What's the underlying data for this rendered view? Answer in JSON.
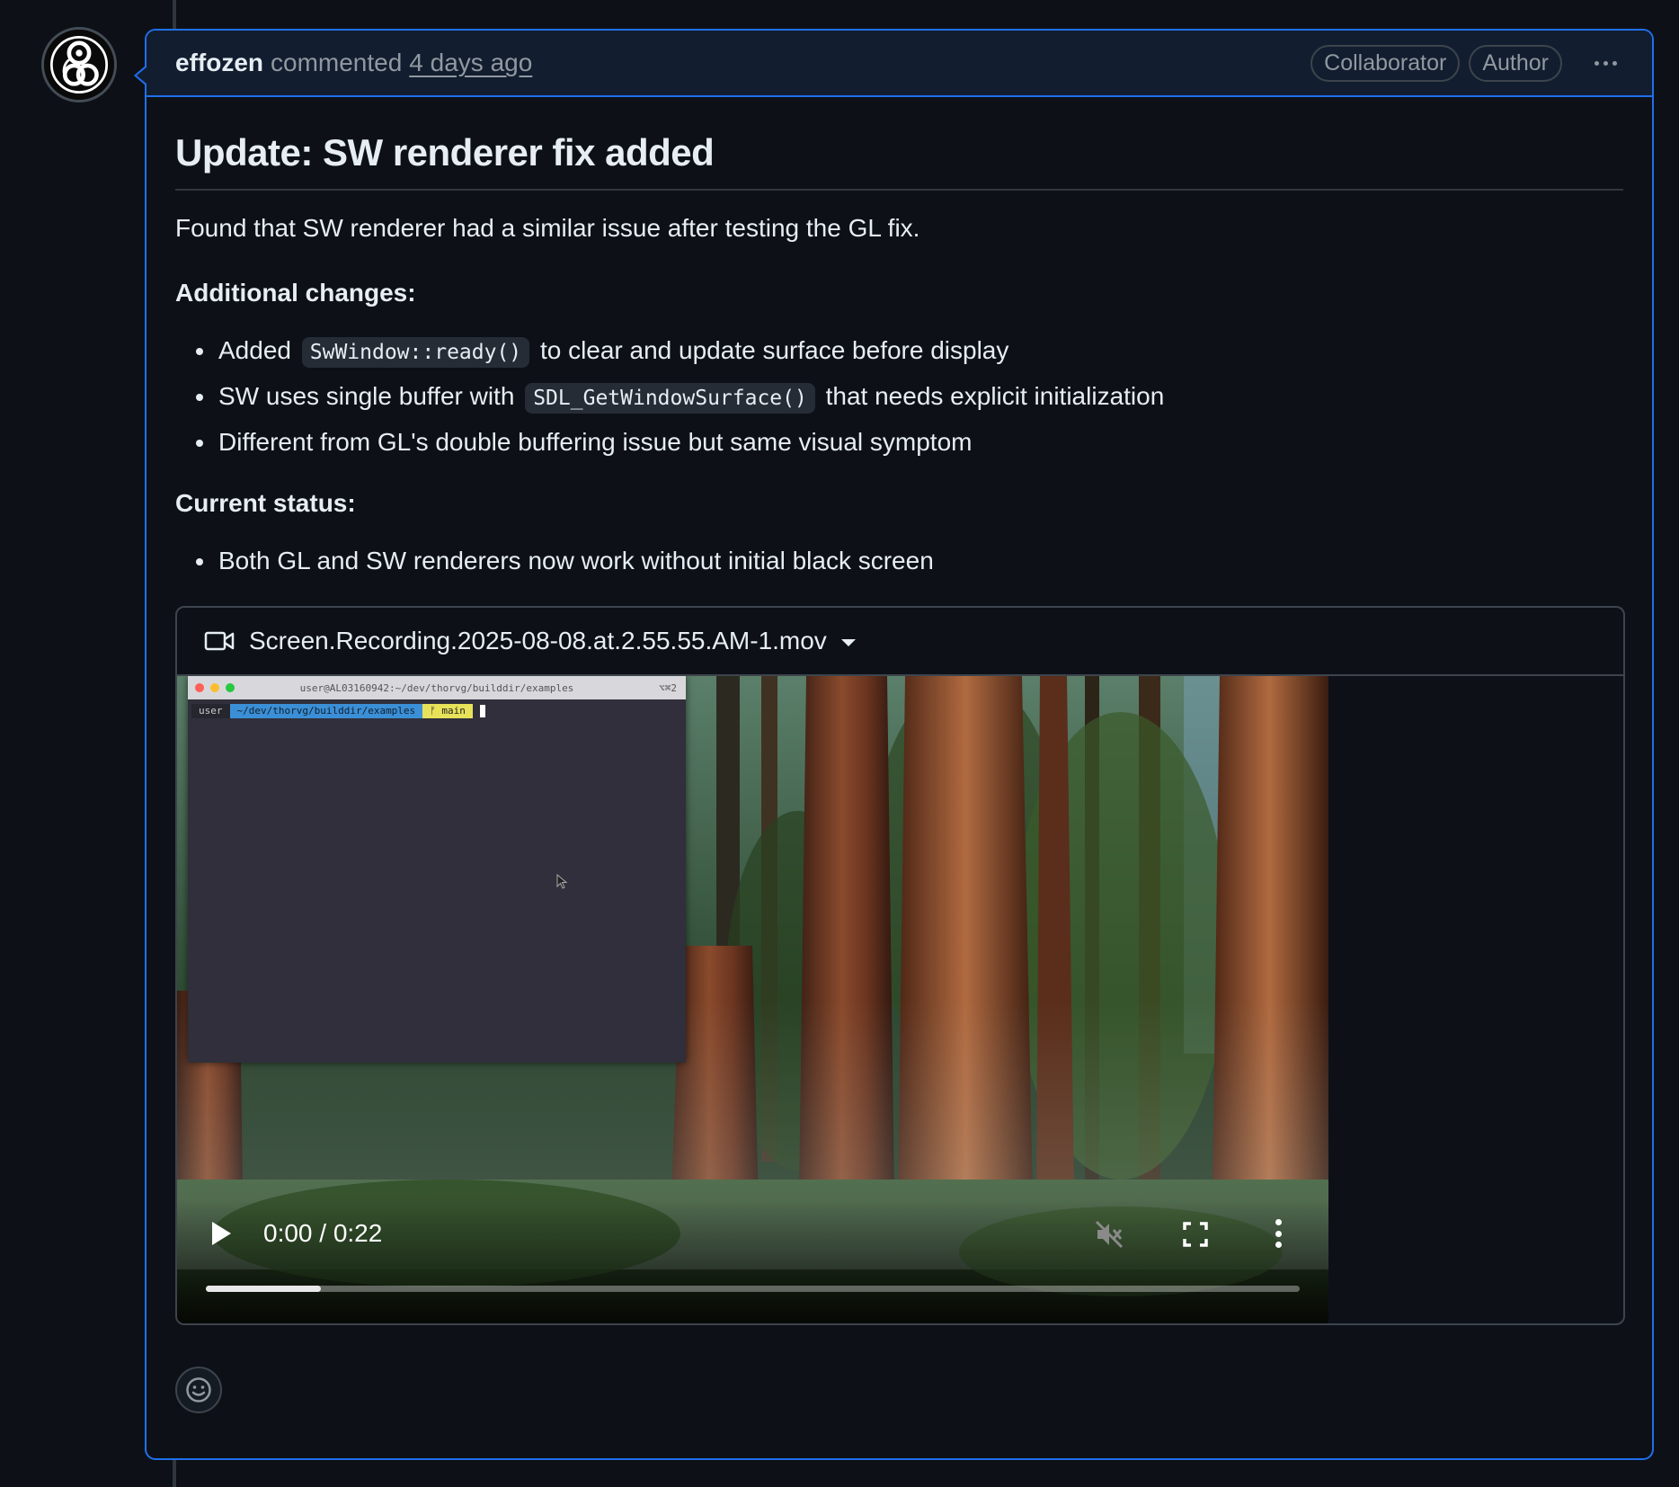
{
  "comment": {
    "author": "effozen",
    "action": "commented",
    "time": "4 days ago",
    "badges": [
      "Collaborator",
      "Author"
    ],
    "menu_icon": "kebab-horizontal-icon"
  },
  "content": {
    "heading": "Update: SW renderer fix added",
    "intro": "Found that SW renderer had a similar issue after testing the GL fix.",
    "section1_title": "Additional changes:",
    "changes": [
      {
        "before": "Added",
        "code": "SwWindow::ready()",
        "after": "to clear and update surface before display"
      },
      {
        "before": "SW uses single buffer with",
        "code": "SDL_GetWindowSurface()",
        "after": "that needs explicit initialization"
      },
      {
        "before": "Different from GL's double buffering issue but same visual symptom",
        "code": "",
        "after": ""
      }
    ],
    "section2_title": "Current status:",
    "status_items": [
      "Both GL and SW renderers now work without initial black screen"
    ]
  },
  "video": {
    "filename": "Screen.Recording.2025-08-08.at.2.55.55.AM-1.mov",
    "time_display": "0:00 / 0:22",
    "progress_fraction": 0.105,
    "terminal": {
      "title": "user@AL03160942:~/dev/thorvg/builddir/examples",
      "shortcut": "⌥⌘2",
      "prompt_user": "user",
      "prompt_path": "~/dev/thorvg/builddir/examples",
      "prompt_branch": "ᚠ main"
    }
  },
  "colors": {
    "accent": "#1f6feb",
    "background": "#0d1117",
    "header_bg": "#121d2f"
  }
}
